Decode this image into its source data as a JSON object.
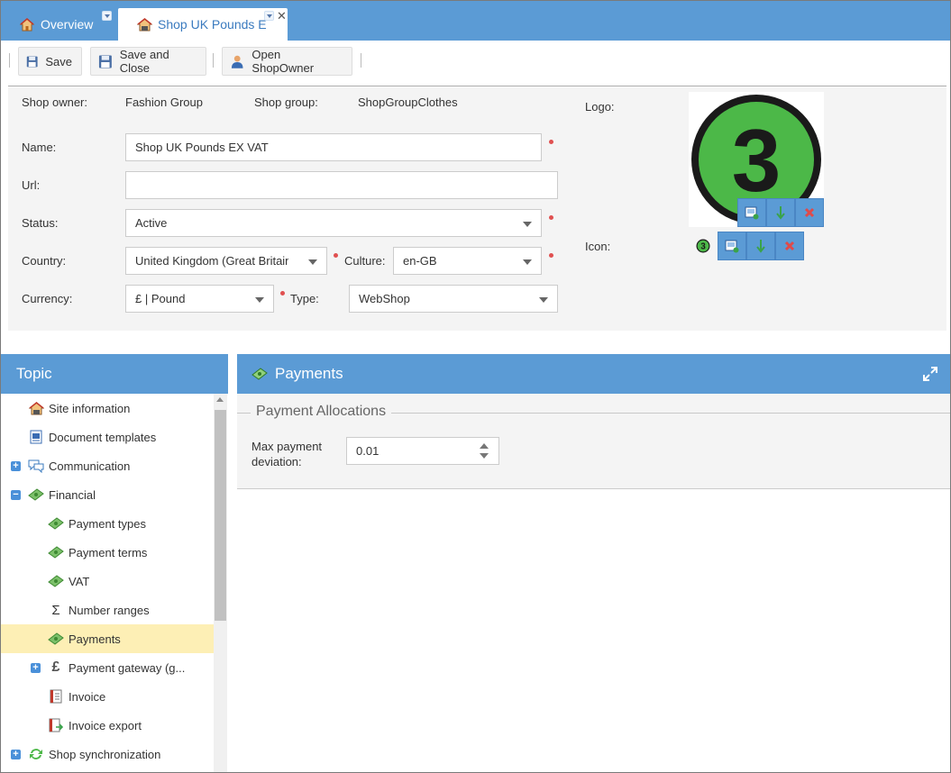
{
  "tabs": [
    {
      "label": "Overview",
      "icon": "house-icon"
    },
    {
      "label": "Shop UK Pounds E",
      "icon": "shop-icon"
    }
  ],
  "toolbar": {
    "save_label": "Save",
    "save_close_label": "Save and Close",
    "open_owner_label": "Open ShopOwner"
  },
  "form": {
    "shop_owner_label": "Shop owner:",
    "shop_owner_value": "Fashion Group",
    "shop_group_label": "Shop group:",
    "shop_group_value": "ShopGroupClothes",
    "logo_label": "Logo:",
    "icon_label": "Icon:",
    "name_label": "Name:",
    "name_value": "Shop UK Pounds EX VAT",
    "url_label": "Url:",
    "url_value": "",
    "status_label": "Status:",
    "status_value": "Active",
    "country_label": "Country:",
    "country_value": "United Kingdom (Great Britain)",
    "culture_label": "Culture:",
    "culture_value": "en-GB",
    "currency_label": "Currency:",
    "currency_value": "£ | Pound",
    "type_label": "Type:",
    "type_value": "WebShop",
    "logo_glyph": "3",
    "icon_glyph": "3"
  },
  "topic": {
    "title": "Topic",
    "items": [
      {
        "label": "Site information",
        "icon": "shop-icon",
        "level": 0,
        "expander": ""
      },
      {
        "label": "Document templates",
        "icon": "document-icon",
        "level": 0,
        "expander": ""
      },
      {
        "label": "Communication",
        "icon": "chat-icon",
        "level": 0,
        "expander": "+"
      },
      {
        "label": "Financial",
        "icon": "money-icon",
        "level": 0,
        "expander": "−"
      },
      {
        "label": "Payment types",
        "icon": "money-icon",
        "level": 1,
        "expander": ""
      },
      {
        "label": "Payment terms",
        "icon": "money-icon",
        "level": 1,
        "expander": ""
      },
      {
        "label": "VAT",
        "icon": "money-icon",
        "level": 1,
        "expander": ""
      },
      {
        "label": "Number ranges",
        "icon": "sigma-icon",
        "level": 1,
        "expander": ""
      },
      {
        "label": "Payments",
        "icon": "money-icon",
        "level": 1,
        "expander": "",
        "selected": true
      },
      {
        "label": "Payment gateway (g...",
        "icon": "pound-icon",
        "level": 1,
        "expander": "+"
      },
      {
        "label": "Invoice",
        "icon": "invoice-icon",
        "level": 1,
        "expander": ""
      },
      {
        "label": "Invoice export",
        "icon": "invoice-export-icon",
        "level": 1,
        "expander": ""
      },
      {
        "label": "Shop synchronization",
        "icon": "sync-icon",
        "level": 0,
        "expander": "+"
      }
    ]
  },
  "payments": {
    "title": "Payments",
    "section_title": "Payment Allocations",
    "max_dev_label_1": "Max payment",
    "max_dev_label_2": "deviation:",
    "max_dev_value": "0.01"
  },
  "colors": {
    "accent": "#5b9bd5",
    "selected_row": "#fdefb5",
    "required": "#e05050",
    "logo_green": "#4cb848"
  }
}
